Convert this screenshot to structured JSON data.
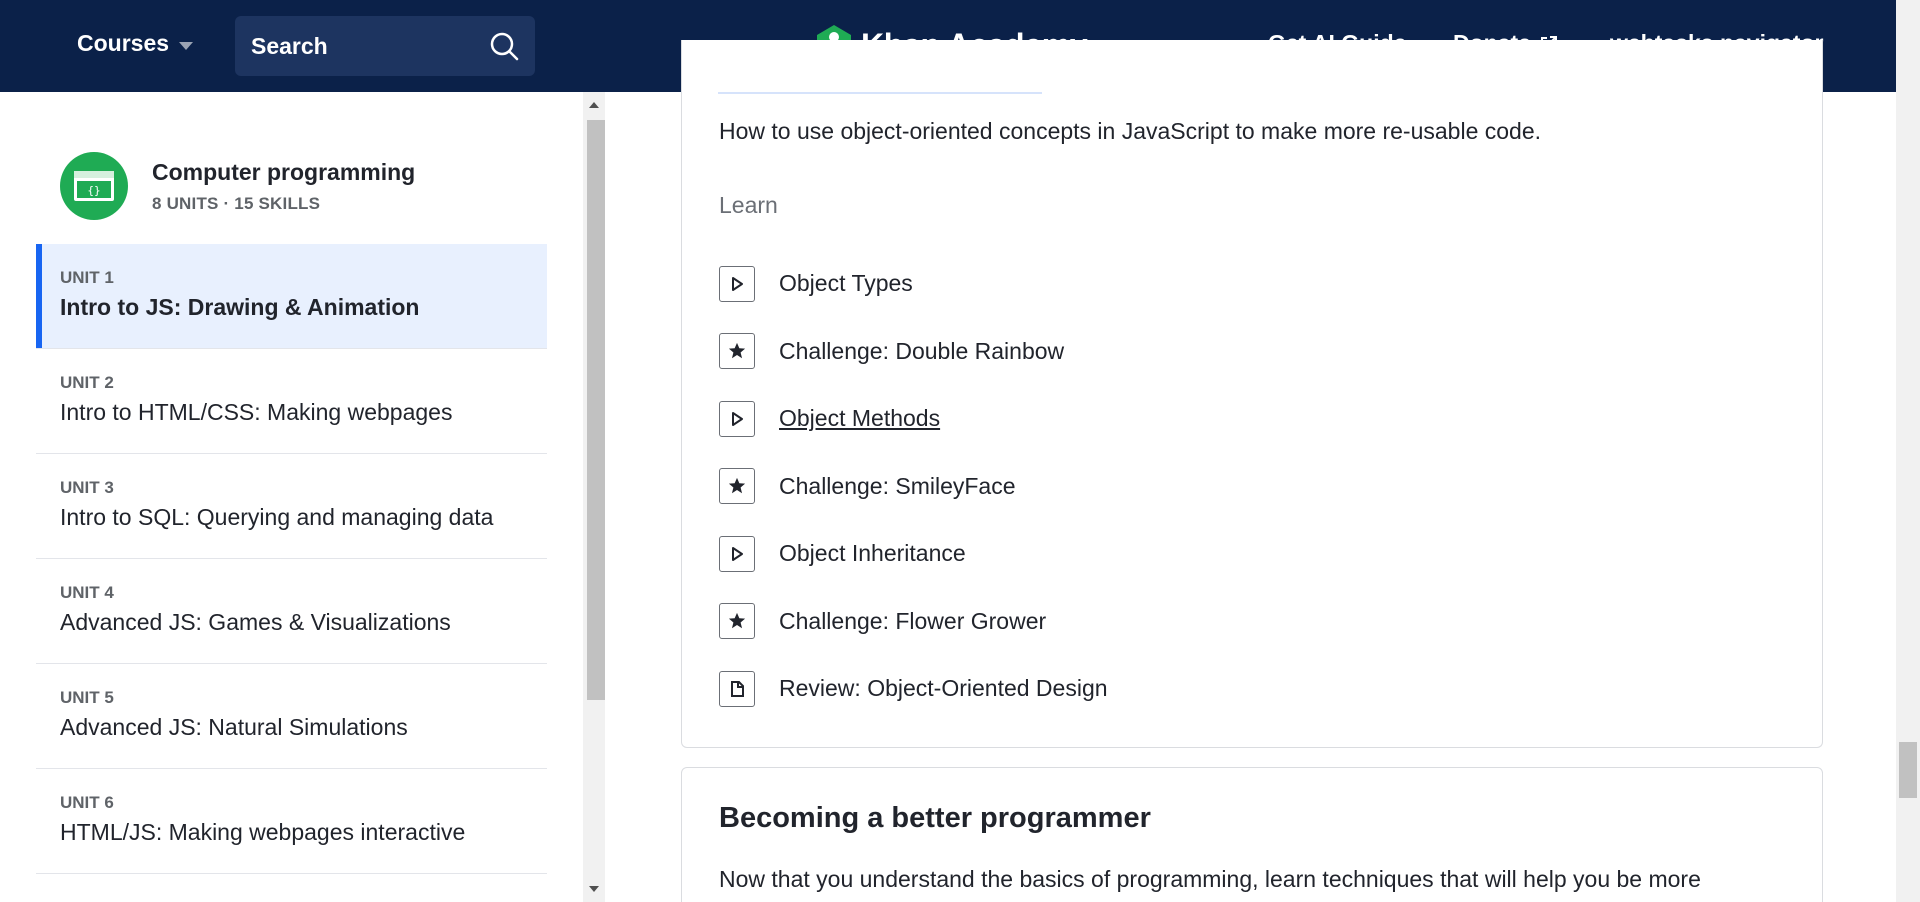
{
  "nav": {
    "courses_label": "Courses",
    "search_label": "Search",
    "logo_text": "Khan Academy",
    "ai_guide": "Get AI Guide",
    "donate": "Donate",
    "user": "webtasks.navigator"
  },
  "sidebar": {
    "course_title": "Computer programming",
    "course_meta": "8 UNITS · 15 SKILLS",
    "units": [
      {
        "num": "UNIT 1",
        "title": "Intro to JS: Drawing & Animation"
      },
      {
        "num": "UNIT 2",
        "title": "Intro to HTML/CSS: Making webpages"
      },
      {
        "num": "UNIT 3",
        "title": "Intro to SQL: Querying and managing data"
      },
      {
        "num": "UNIT 4",
        "title": "Advanced JS: Games & Visualizations"
      },
      {
        "num": "UNIT 5",
        "title": "Advanced JS: Natural Simulations"
      },
      {
        "num": "UNIT 6",
        "title": "HTML/JS: Making webpages interactive"
      }
    ]
  },
  "main": {
    "description": "How to use object-oriented concepts in JavaScript to make more re-usable code.",
    "learn_heading": "Learn",
    "lessons": [
      {
        "icon": "play-icon",
        "label": "Object Types"
      },
      {
        "icon": "star-icon",
        "label": "Challenge: Double Rainbow"
      },
      {
        "icon": "play-icon",
        "label": "Object Methods"
      },
      {
        "icon": "star-icon",
        "label": "Challenge: SmileyFace"
      },
      {
        "icon": "play-icon",
        "label": "Object Inheritance"
      },
      {
        "icon": "star-icon",
        "label": "Challenge: Flower Grower"
      },
      {
        "icon": "document-icon",
        "label": "Review: Object-Oriented Design"
      }
    ],
    "next_section_title": "Becoming a better programmer",
    "next_section_desc": "Now that you understand the basics of programming, learn techniques that will help you be more"
  },
  "colors": {
    "nav_bg": "#0b2149",
    "brand_green": "#1fab54",
    "active_blue": "#1865f2"
  }
}
